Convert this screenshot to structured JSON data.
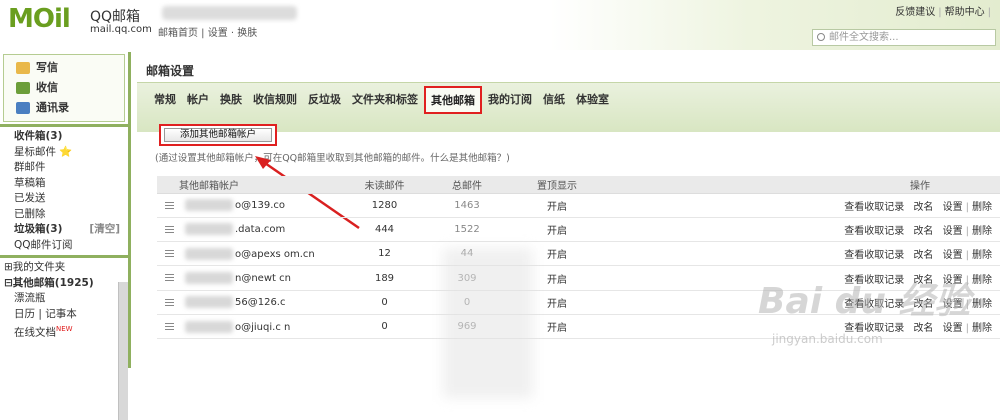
{
  "header": {
    "logo_text": "MOil",
    "logo_brand": "QQ邮箱",
    "logo_domain": "mail.qq.com",
    "top_links": "邮箱首页 | 设置 · 换肤",
    "feedback": "反馈建议",
    "help": "帮助中心",
    "search_placeholder": "邮件全文搜索..."
  },
  "sidebar": {
    "actions": [
      "写信",
      "收信",
      "通讯录"
    ],
    "folders": [
      {
        "label": "收件箱(3)",
        "bold": true
      },
      {
        "label": "星标邮件 ⭐"
      },
      {
        "label": "群邮件"
      },
      {
        "label": "草稿箱"
      },
      {
        "label": "已发送"
      },
      {
        "label": "已删除"
      },
      {
        "label": "垃圾箱(3)",
        "bold": true,
        "tag": "[清空]"
      },
      {
        "label": "QQ邮件订阅"
      }
    ],
    "folders2": [
      {
        "label": "⊞我的文件夹"
      },
      {
        "label": "⊟其他邮箱(1925)",
        "bold": true
      },
      {
        "label": "漂流瓶"
      },
      {
        "label": "日历 | 记事本"
      },
      {
        "label": "在线文档"
      }
    ],
    "new_badge": "NEW"
  },
  "main": {
    "title": "邮箱设置",
    "tabs": [
      "常规",
      "帐户",
      "换肤",
      "收信规则",
      "反垃圾",
      "文件夹和标签",
      "其他邮箱",
      "我的订阅",
      "信纸",
      "体验室"
    ],
    "active_tab": "其他邮箱",
    "add_button": "添加其他邮箱帐户",
    "hint": "(通过设置其他邮箱帐户，可在QQ邮箱里收取到其他邮箱的邮件。什么是其他邮箱？)",
    "columns": [
      "其他邮箱帐户",
      "未读邮件",
      "总邮件",
      "置顶显示",
      "操作"
    ],
    "rows": [
      {
        "account": "o@139.co",
        "unread": "1280",
        "total": "1463",
        "pin": "开启"
      },
      {
        "account": ".data.com",
        "unread": "444",
        "total": "1522",
        "pin": "开启"
      },
      {
        "account": "o@apexs  om.cn",
        "unread": "12",
        "total": "44",
        "pin": "开启"
      },
      {
        "account": "n@newt   cn",
        "unread": "189",
        "total": "309",
        "pin": "开启"
      },
      {
        "account": "56@126.c",
        "unread": "0",
        "total": "0",
        "pin": "开启"
      },
      {
        "account": "o@jiuqi.c  n",
        "unread": "0",
        "total": "969",
        "pin": "开启"
      }
    ],
    "ops": {
      "records": "查看收取记录",
      "rename": "改名",
      "settings": "设置",
      "delete": "删除"
    }
  },
  "watermark": {
    "text": "Bai du 经验",
    "url": "jingyan.baidu.com"
  },
  "colors": {
    "accent_green": "#8fb05f",
    "highlight_red": "#e02020"
  }
}
